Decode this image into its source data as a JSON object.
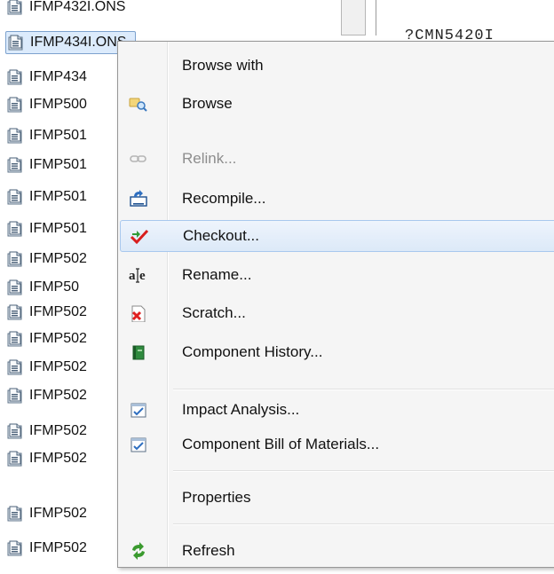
{
  "tree": {
    "items": [
      {
        "label": "IFMP432I.ONS"
      },
      {
        "label": "IFMP434I.ONS"
      },
      {
        "label": "IFMP434"
      },
      {
        "label": "IFMP500"
      },
      {
        "label": "IFMP501"
      },
      {
        "label": "IFMP501"
      },
      {
        "label": "IFMP501"
      },
      {
        "label": "IFMP501"
      },
      {
        "label": "IFMP502"
      },
      {
        "label": "IFMP50"
      },
      {
        "label": "IFMP502"
      },
      {
        "label": "IFMP502"
      },
      {
        "label": "IFMP502"
      },
      {
        "label": "IFMP502"
      },
      {
        "label": "IFMP502"
      },
      {
        "label": "IFMP502"
      },
      {
        "label": "IFMP502"
      },
      {
        "label": "IFMP502"
      }
    ]
  },
  "editor": {
    "lines": [
      "?CMN5420I"
    ]
  },
  "context_menu": {
    "items": [
      {
        "label": "Browse with",
        "icon": "none"
      },
      {
        "label": "Browse",
        "icon": "browse-icon"
      },
      {
        "label": "Relink...",
        "icon": "link-icon",
        "disabled": true
      },
      {
        "label": "Recompile...",
        "icon": "recompile-icon"
      },
      {
        "label": "Checkout...",
        "icon": "checkout-icon"
      },
      {
        "label": "Rename...",
        "icon": "rename-icon"
      },
      {
        "label": "Scratch...",
        "icon": "scratch-icon"
      },
      {
        "label": "Component History...",
        "icon": "history-book-icon"
      },
      {
        "label": "Impact Analysis...",
        "icon": "impact-analysis-icon"
      },
      {
        "label": "Component Bill of Materials...",
        "icon": "bill-of-materials-icon"
      },
      {
        "label": "Properties",
        "icon": "none"
      },
      {
        "label": "Refresh",
        "icon": "refresh-icon"
      }
    ]
  },
  "colors": {
    "selection_fill": "#dcebfc",
    "selection_border": "#7da2ce",
    "menu_background": "#f5f5f5",
    "disabled_text": "#8d8d8d"
  }
}
